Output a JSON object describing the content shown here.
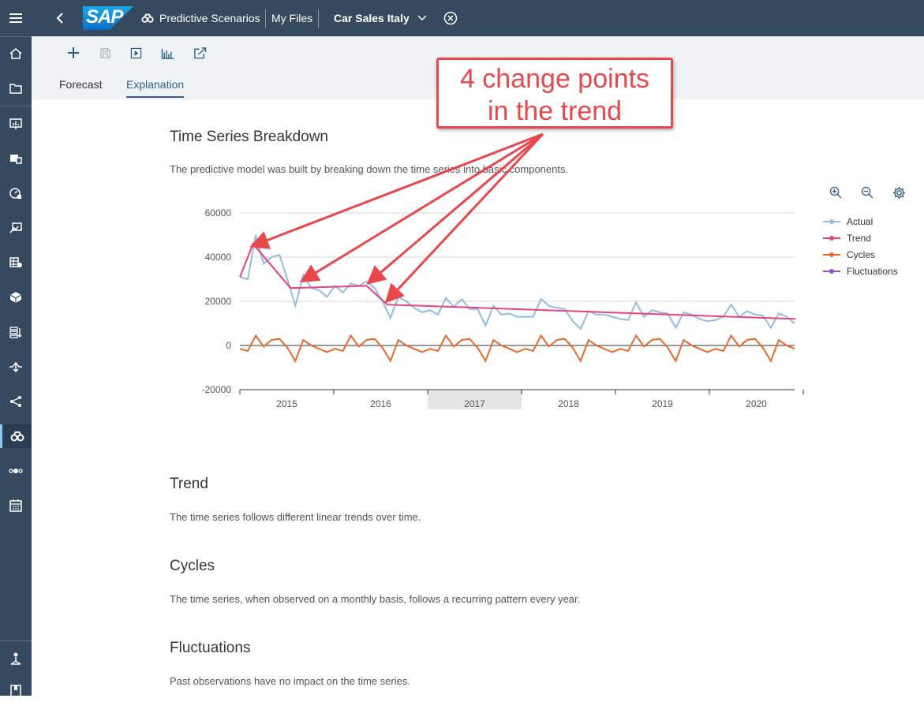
{
  "header": {
    "brand": "SAP",
    "app_name": "Predictive Scenarios",
    "breadcrumb": "My Files",
    "file_title": "Car Sales Italy"
  },
  "toolbar": {
    "tools": [
      "add-icon",
      "save-icon",
      "run-icon",
      "train-icon",
      "share-icon"
    ],
    "tabs": {
      "forecast": "Forecast",
      "explanation": "Explanation"
    },
    "active_tab": "Explanation"
  },
  "left_nav": {
    "icons": [
      "menu-icon",
      "home-icon",
      "files-icon",
      "stories-icon",
      "analytic-app-icon",
      "digital-boardroom-icon",
      "applications-icon",
      "modeler-icon",
      "data-icon",
      "data-actions-icon",
      "connections-icon",
      "flow-icon",
      "predictive-icon",
      "process-icon",
      "calendar-icon",
      "deployment-icon",
      "learning-icon"
    ],
    "active": "predictive-icon"
  },
  "content": {
    "breakdown_title": "Time Series Breakdown",
    "breakdown_desc": "The predictive model was built by breaking down the time series into basic components.",
    "trend_title": "Trend",
    "trend_desc": "The time series follows different linear trends over time.",
    "cycles_title": "Cycles",
    "cycles_desc": "The time series, when observed on a monthly basis, follows a recurring pattern every year.",
    "fluct_title": "Fluctuations",
    "fluct_desc": "Past observations have no impact on the time series."
  },
  "callout": {
    "line1": "4 change points",
    "line2": "in the trend",
    "color": "#e8474c"
  },
  "chart_data": {
    "type": "line",
    "x_start_year": 2014.5,
    "y_ticks": [
      "60000",
      "40000",
      "20000",
      "0",
      "-20000"
    ],
    "ylim": [
      -20000,
      60000
    ],
    "x_ticks": [
      "2015",
      "2016",
      "2017",
      "2018",
      "2019",
      "2020"
    ],
    "highlighted_year": "2017",
    "grid": true,
    "legend_position": "right",
    "colors": {
      "Actual": "#91bde5",
      "Trend": "#e8437b",
      "Cycles": "#e8692c",
      "Fluctuations": "#8d4ec8"
    },
    "series": [
      {
        "name": "Actual",
        "values": [
          31000,
          30000,
          50000,
          37000,
          40000,
          41000,
          30000,
          18000,
          32000,
          26000,
          25000,
          22000,
          27000,
          24000,
          28000,
          27000,
          29000,
          26000,
          20000,
          12500,
          22000,
          20000,
          17000,
          15000,
          16000,
          14000,
          21500,
          17500,
          21000,
          16500,
          16500,
          9000,
          18000,
          14000,
          14500,
          13000,
          13000,
          13000,
          21000,
          18000,
          17000,
          16500,
          11000,
          7500,
          15500,
          14000,
          14000,
          13000,
          12000,
          11500,
          19500,
          13000,
          16000,
          15000,
          14500,
          8000,
          15000,
          14000,
          12000,
          11000,
          11500,
          13000,
          18500,
          13000,
          15500,
          14000,
          13500,
          8000,
          14500,
          13000,
          10000
        ],
        "yearly_pattern_note": ""
      },
      {
        "name": "Trend",
        "points": [
          [
            2014.5,
            31000
          ],
          [
            2014.64,
            46000
          ],
          [
            2015.04,
            26000
          ],
          [
            2015.85,
            27000
          ],
          [
            2016.07,
            18500
          ],
          [
            2020.42,
            12000
          ]
        ]
      },
      {
        "name": "Cycles",
        "yearly": [
          -1500,
          -2500,
          4500,
          -500,
          2500,
          3000,
          -1000,
          -7000,
          2500,
          0,
          -1500,
          -3000
        ]
      },
      {
        "name": "Fluctuations",
        "values": []
      }
    ]
  }
}
